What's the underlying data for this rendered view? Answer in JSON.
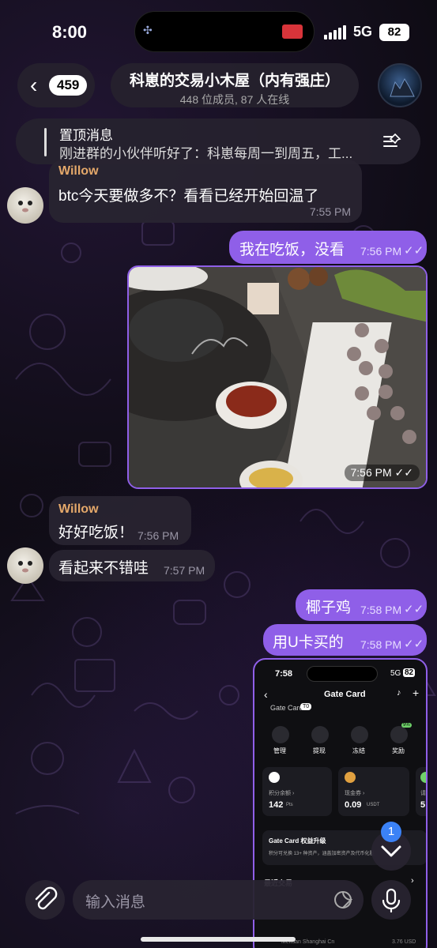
{
  "status": {
    "time": "8:00",
    "network": "5G",
    "battery": "82"
  },
  "header": {
    "back_count": "459",
    "title": "科崽的交易小木屋（内有强庄）",
    "subtitle": "448 位成员, 87 人在线"
  },
  "pinned": {
    "label": "置顶消息",
    "text": "刚进群的小伙伴听好了：科崽每周一到周五，工..."
  },
  "messages": [
    {
      "sender": "Willow",
      "text": "btc今天要做多不？看看已经开始回温了",
      "time": "7:55 PM"
    },
    {
      "text": "我在吃饭，没看",
      "time": "7:56 PM"
    },
    {
      "photo_time": "7:56 PM"
    },
    {
      "sender": "Willow",
      "text": "好好吃饭！",
      "time": "7:56 PM"
    },
    {
      "text": "看起来不错哇",
      "time": "7:57 PM"
    },
    {
      "text": "椰子鸡",
      "time": "7:58 PM"
    },
    {
      "text": "用U卡买的",
      "time": "7:58 PM"
    }
  ],
  "screenshot": {
    "time": "7:58",
    "network": "5G",
    "battery": "82",
    "title": "Gate Card",
    "card_label": "Gate Card",
    "card_badge": "T0",
    "actions": [
      "管理",
      "提现",
      "冻结",
      "奖励"
    ],
    "badge": "9%",
    "points_label": "积分余额 ›",
    "points_value": "142",
    "points_unit": "Pts",
    "voucher_label": "现金券 ›",
    "voucher_value": "0.09",
    "voucher_unit": "USDT",
    "third_label": "请",
    "third_value": "5",
    "upgrade_title": "Gate Card 权益升级",
    "upgrade_text": "积分可兑换 13+ 种资产，涵盖加密资产及代币化股",
    "recent_label": "最近交易",
    "tx_name": "Meituan Shanghai Cn",
    "tx_amount": "3.76 USD"
  },
  "input": {
    "placeholder": "输入消息"
  },
  "scroll": {
    "unread": "1"
  }
}
